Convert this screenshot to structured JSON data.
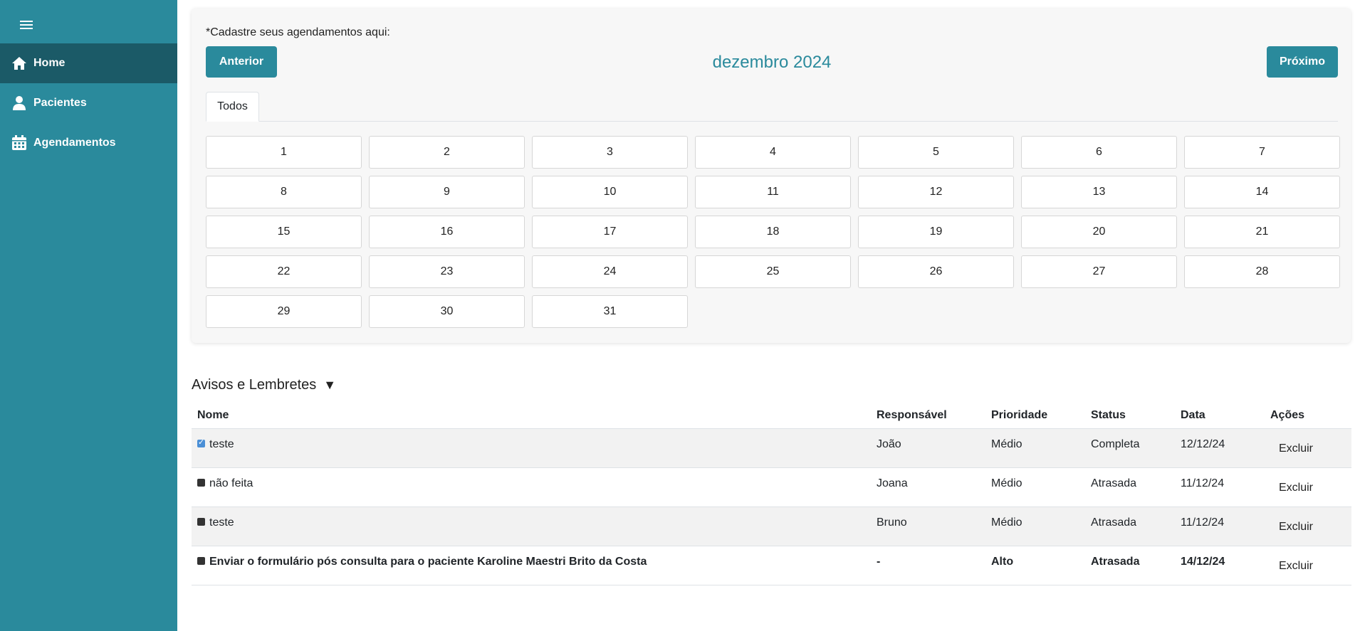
{
  "sidebar": {
    "items": [
      {
        "label": "Home",
        "icon": "home-icon",
        "active": true
      },
      {
        "label": "Pacientes",
        "icon": "user-icon",
        "active": false
      },
      {
        "label": "Agendamentos",
        "icon": "calendar-icon",
        "active": false
      }
    ]
  },
  "calendar": {
    "hint": "*Cadastre seus agendamentos aqui:",
    "prev_label": "Anterior",
    "next_label": "Próximo",
    "month_title": "dezembro 2024",
    "tab_label": "Todos",
    "days": [
      "1",
      "2",
      "3",
      "4",
      "5",
      "6",
      "7",
      "8",
      "9",
      "10",
      "11",
      "12",
      "13",
      "14",
      "15",
      "16",
      "17",
      "18",
      "19",
      "20",
      "21",
      "22",
      "23",
      "24",
      "25",
      "26",
      "27",
      "28",
      "29",
      "30",
      "31"
    ]
  },
  "notices": {
    "title": "Avisos e Lembretes",
    "toggle_glyph": "▼",
    "headers": {
      "nome": "Nome",
      "responsavel": "Responsável",
      "prioridade": "Prioridade",
      "status": "Status",
      "data": "Data",
      "acoes": "Ações"
    },
    "rows": [
      {
        "nome": "teste",
        "responsavel": "João",
        "prioridade": "Médio",
        "status": "Completa",
        "data": "12/12/24",
        "acao": "Excluir",
        "checked": true
      },
      {
        "nome": "não feita",
        "responsavel": "Joana",
        "prioridade": "Médio",
        "status": "Atrasada",
        "data": "11/12/24",
        "acao": "Excluir",
        "checked": false
      },
      {
        "nome": "teste",
        "responsavel": "Bruno",
        "prioridade": "Médio",
        "status": "Atrasada",
        "data": "11/12/24",
        "acao": "Excluir",
        "checked": false
      },
      {
        "nome": "Enviar o formulário pós consulta para o paciente Karoline Maestri Brito da Costa",
        "responsavel": "-",
        "prioridade": "Alto",
        "status": "Atrasada",
        "data": "14/12/24",
        "acao": "Excluir",
        "checked": false
      }
    ]
  },
  "colors": {
    "sidebar": "#2a8a9c",
    "sidebar_active": "#1b5a67",
    "accent": "#2a8a9c"
  }
}
